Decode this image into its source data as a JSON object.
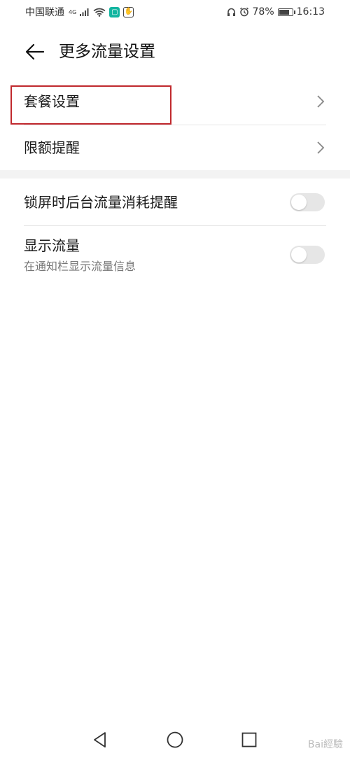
{
  "status_bar": {
    "carrier": "中国联通",
    "network": "4G",
    "battery": "78%",
    "battery_level": 0.78,
    "time": "16:13"
  },
  "header": {
    "title": "更多流量设置"
  },
  "rows": {
    "plan_settings": "套餐设置",
    "limit_reminder": "限额提醒",
    "lockscreen_reminder": "锁屏时后台流量消耗提醒",
    "show_traffic": "显示流量",
    "show_traffic_sub": "在通知栏显示流量信息"
  },
  "toggles": {
    "lockscreen_reminder_on": false,
    "show_traffic_on": false
  },
  "watermark": "Bai經驗"
}
